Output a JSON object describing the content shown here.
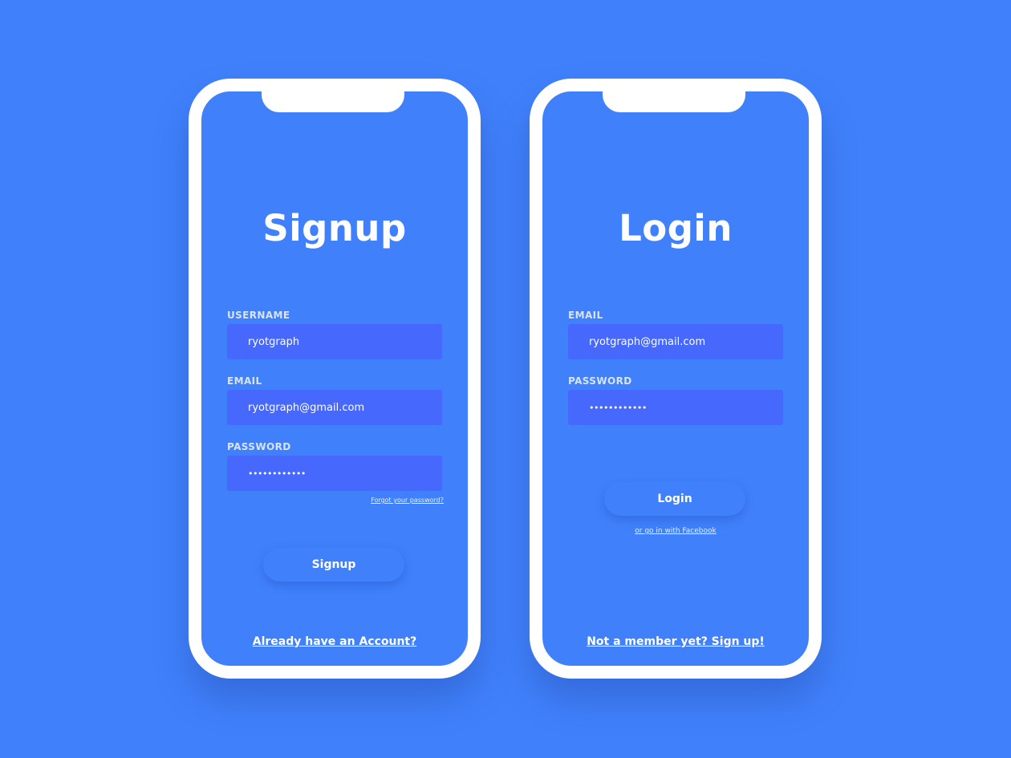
{
  "colors": {
    "background": "#4081fb",
    "frame": "#ffffff",
    "input_fill": "#4768fc",
    "label": "#d6e4ff",
    "text": "#ffffff"
  },
  "signup": {
    "title": "Signup",
    "username": {
      "label": "USERNAME",
      "value": "ryotgraph"
    },
    "email": {
      "label": "EMAIL",
      "value": "ryotgraph@gmail.com"
    },
    "password": {
      "label": "PASSWORD",
      "value": "••••••••••••"
    },
    "forgot_link": "Forgot your password?",
    "button_label": "Signup",
    "bottom_link": "Already have an Account?"
  },
  "login": {
    "title": "Login",
    "email": {
      "label": "EMAIL",
      "value": "ryotgraph@gmail.com"
    },
    "password": {
      "label": "PASSWORD",
      "value": "••••••••••••"
    },
    "button_label": "Login",
    "facebook_link": "or go in with Facebook",
    "bottom_link": "Not a member yet? Sign up!"
  }
}
